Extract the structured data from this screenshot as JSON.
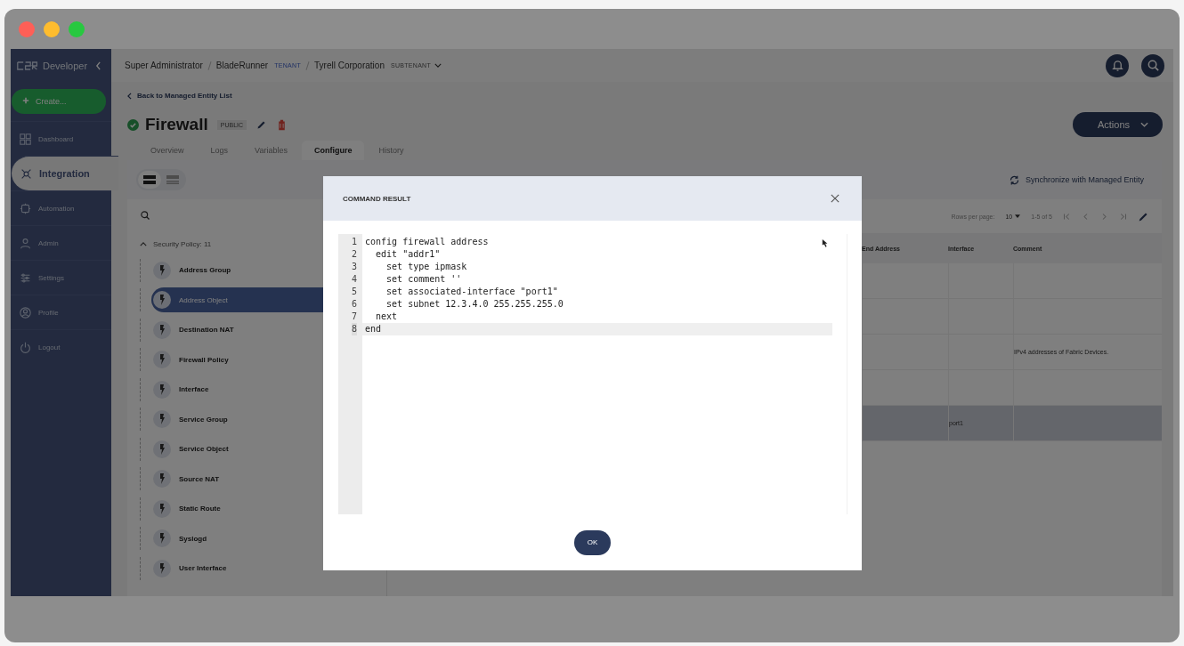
{
  "sidebar": {
    "brand": "Developer",
    "create_button": "Create...",
    "items": [
      {
        "label": "Dashboard",
        "kind": "dashboard",
        "selected": false
      },
      {
        "label": "Integration",
        "kind": "integration",
        "selected": true
      },
      {
        "label": "Automation",
        "kind": "automation",
        "selected": false
      },
      {
        "label": "Admin",
        "kind": "admin",
        "selected": false
      },
      {
        "label": "Settings",
        "kind": "settings",
        "selected": false
      },
      {
        "label": "Profile",
        "kind": "profile",
        "selected": false
      },
      {
        "label": "Logout",
        "kind": "logout",
        "selected": false
      }
    ]
  },
  "breadcrumb": [
    {
      "label": "Super Administrator"
    },
    {
      "label": "BladeRunner",
      "tag": "TENANT"
    },
    {
      "label": "Tyrell Corporation",
      "tag": "SUBTENANT"
    }
  ],
  "back_link": "Back to Managed Entity List",
  "entity": {
    "title": "Firewall",
    "badge": "PUBLIC"
  },
  "actions_button": "Actions",
  "tabs": [
    {
      "label": "Overview",
      "selected": false
    },
    {
      "label": "Logs",
      "selected": false
    },
    {
      "label": "Variables",
      "selected": false
    },
    {
      "label": "Configure",
      "selected": true
    },
    {
      "label": "History",
      "selected": false
    }
  ],
  "view_toggle": [
    {
      "kind": "cards",
      "selected": true
    },
    {
      "kind": "list",
      "selected": false
    }
  ],
  "sync_link": "Synchronize with Managed Entity",
  "tree": {
    "label": "Security Policy: 11",
    "expanded": true,
    "children": [
      {
        "label": "Address Group",
        "selected": false
      },
      {
        "label": "Address Object",
        "selected": true
      },
      {
        "label": "Destination NAT",
        "selected": false
      },
      {
        "label": "Firewall Policy",
        "selected": false
      },
      {
        "label": "Interface",
        "selected": false
      },
      {
        "label": "Service Group",
        "selected": false
      },
      {
        "label": "Service Object",
        "selected": false
      },
      {
        "label": "Source NAT",
        "selected": false
      },
      {
        "label": "Static Route",
        "selected": false
      },
      {
        "label": "Syslogd",
        "selected": false
      },
      {
        "label": "User Interface",
        "selected": false
      }
    ]
  },
  "pagination": {
    "rows_label": "Rows per page:",
    "rows_value": "10",
    "range": "1-5 of 5"
  },
  "table": {
    "columns": [
      "End Address",
      "Interface",
      "Comment"
    ],
    "rows": [
      {
        "cells": [
          null,
          null,
          null
        ],
        "selected": false
      },
      {
        "cells": [
          null,
          null,
          null
        ],
        "selected": false
      },
      {
        "cells": [
          null,
          null,
          "IPv4 addresses of Fabric Devices."
        ],
        "selected": false
      },
      {
        "cells": [
          null,
          null,
          null
        ],
        "selected": false
      },
      {
        "cells": [
          null,
          "port1",
          null
        ],
        "selected": true
      }
    ]
  },
  "modal": {
    "title": "COMMAND RESULT",
    "lines": [
      {
        "number": "1",
        "text": "config firewall address",
        "active": false
      },
      {
        "number": "2",
        "text": "  edit \"addr1\"",
        "active": false
      },
      {
        "number": "3",
        "text": "    set type ipmask",
        "active": false
      },
      {
        "number": "4",
        "text": "    set comment ''",
        "active": false
      },
      {
        "number": "5",
        "text": "    set associated-interface \"port1\"",
        "active": false
      },
      {
        "number": "6",
        "text": "    set subnet 12.3.4.0 255.255.255.0",
        "active": false
      },
      {
        "number": "7",
        "text": "  next",
        "active": false
      },
      {
        "number": "8",
        "text": "end",
        "active": true
      }
    ],
    "ok_button": "OK"
  }
}
